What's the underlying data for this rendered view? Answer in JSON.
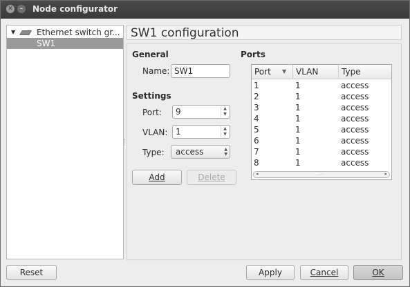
{
  "window": {
    "title": "Node configurator"
  },
  "tree": {
    "group_label": "Ethernet switch gr...",
    "selected_item": "SW1"
  },
  "config": {
    "title": "SW1 configuration",
    "general": {
      "section_label": "General",
      "name_label": "Name:",
      "name_value": "SW1"
    },
    "settings": {
      "section_label": "Settings",
      "port_label": "Port:",
      "port_value": "9",
      "vlan_label": "VLAN:",
      "vlan_value": "1",
      "type_label": "Type:",
      "type_value": "access"
    },
    "add_label": "Add",
    "delete_label": "Delete",
    "ports": {
      "section_label": "Ports",
      "columns": [
        "Port",
        "VLAN",
        "Type"
      ],
      "rows": [
        [
          "1",
          "1",
          "access"
        ],
        [
          "2",
          "1",
          "access"
        ],
        [
          "3",
          "1",
          "access"
        ],
        [
          "4",
          "1",
          "access"
        ],
        [
          "5",
          "1",
          "access"
        ],
        [
          "6",
          "1",
          "access"
        ],
        [
          "7",
          "1",
          "access"
        ],
        [
          "8",
          "1",
          "access"
        ]
      ]
    }
  },
  "footer": {
    "reset_label": "Reset",
    "apply_label": "Apply",
    "cancel_label": "Cancel",
    "ok_label": "OK"
  }
}
